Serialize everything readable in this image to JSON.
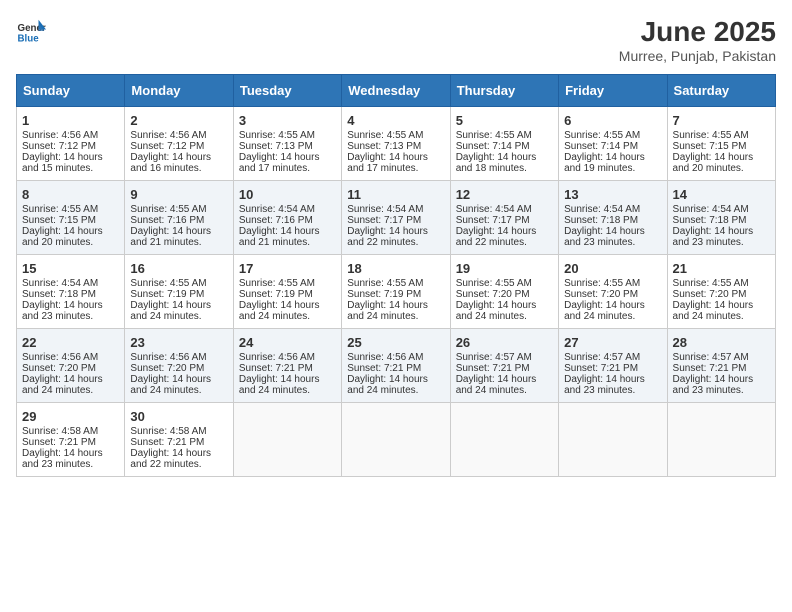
{
  "app": {
    "name_general": "General",
    "name_blue": "Blue"
  },
  "title": "June 2025",
  "subtitle": "Murree, Punjab, Pakistan",
  "weekdays": [
    "Sunday",
    "Monday",
    "Tuesday",
    "Wednesday",
    "Thursday",
    "Friday",
    "Saturday"
  ],
  "weeks": [
    [
      {
        "day": 1,
        "lines": [
          "Sunrise: 4:56 AM",
          "Sunset: 7:12 PM",
          "Daylight: 14 hours",
          "and 15 minutes."
        ]
      },
      {
        "day": 2,
        "lines": [
          "Sunrise: 4:56 AM",
          "Sunset: 7:12 PM",
          "Daylight: 14 hours",
          "and 16 minutes."
        ]
      },
      {
        "day": 3,
        "lines": [
          "Sunrise: 4:55 AM",
          "Sunset: 7:13 PM",
          "Daylight: 14 hours",
          "and 17 minutes."
        ]
      },
      {
        "day": 4,
        "lines": [
          "Sunrise: 4:55 AM",
          "Sunset: 7:13 PM",
          "Daylight: 14 hours",
          "and 17 minutes."
        ]
      },
      {
        "day": 5,
        "lines": [
          "Sunrise: 4:55 AM",
          "Sunset: 7:14 PM",
          "Daylight: 14 hours",
          "and 18 minutes."
        ]
      },
      {
        "day": 6,
        "lines": [
          "Sunrise: 4:55 AM",
          "Sunset: 7:14 PM",
          "Daylight: 14 hours",
          "and 19 minutes."
        ]
      },
      {
        "day": 7,
        "lines": [
          "Sunrise: 4:55 AM",
          "Sunset: 7:15 PM",
          "Daylight: 14 hours",
          "and 20 minutes."
        ]
      }
    ],
    [
      {
        "day": 8,
        "lines": [
          "Sunrise: 4:55 AM",
          "Sunset: 7:15 PM",
          "Daylight: 14 hours",
          "and 20 minutes."
        ]
      },
      {
        "day": 9,
        "lines": [
          "Sunrise: 4:55 AM",
          "Sunset: 7:16 PM",
          "Daylight: 14 hours",
          "and 21 minutes."
        ]
      },
      {
        "day": 10,
        "lines": [
          "Sunrise: 4:54 AM",
          "Sunset: 7:16 PM",
          "Daylight: 14 hours",
          "and 21 minutes."
        ]
      },
      {
        "day": 11,
        "lines": [
          "Sunrise: 4:54 AM",
          "Sunset: 7:17 PM",
          "Daylight: 14 hours",
          "and 22 minutes."
        ]
      },
      {
        "day": 12,
        "lines": [
          "Sunrise: 4:54 AM",
          "Sunset: 7:17 PM",
          "Daylight: 14 hours",
          "and 22 minutes."
        ]
      },
      {
        "day": 13,
        "lines": [
          "Sunrise: 4:54 AM",
          "Sunset: 7:18 PM",
          "Daylight: 14 hours",
          "and 23 minutes."
        ]
      },
      {
        "day": 14,
        "lines": [
          "Sunrise: 4:54 AM",
          "Sunset: 7:18 PM",
          "Daylight: 14 hours",
          "and 23 minutes."
        ]
      }
    ],
    [
      {
        "day": 15,
        "lines": [
          "Sunrise: 4:54 AM",
          "Sunset: 7:18 PM",
          "Daylight: 14 hours",
          "and 23 minutes."
        ]
      },
      {
        "day": 16,
        "lines": [
          "Sunrise: 4:55 AM",
          "Sunset: 7:19 PM",
          "Daylight: 14 hours",
          "and 24 minutes."
        ]
      },
      {
        "day": 17,
        "lines": [
          "Sunrise: 4:55 AM",
          "Sunset: 7:19 PM",
          "Daylight: 14 hours",
          "and 24 minutes."
        ]
      },
      {
        "day": 18,
        "lines": [
          "Sunrise: 4:55 AM",
          "Sunset: 7:19 PM",
          "Daylight: 14 hours",
          "and 24 minutes."
        ]
      },
      {
        "day": 19,
        "lines": [
          "Sunrise: 4:55 AM",
          "Sunset: 7:20 PM",
          "Daylight: 14 hours",
          "and 24 minutes."
        ]
      },
      {
        "day": 20,
        "lines": [
          "Sunrise: 4:55 AM",
          "Sunset: 7:20 PM",
          "Daylight: 14 hours",
          "and 24 minutes."
        ]
      },
      {
        "day": 21,
        "lines": [
          "Sunrise: 4:55 AM",
          "Sunset: 7:20 PM",
          "Daylight: 14 hours",
          "and 24 minutes."
        ]
      }
    ],
    [
      {
        "day": 22,
        "lines": [
          "Sunrise: 4:56 AM",
          "Sunset: 7:20 PM",
          "Daylight: 14 hours",
          "and 24 minutes."
        ]
      },
      {
        "day": 23,
        "lines": [
          "Sunrise: 4:56 AM",
          "Sunset: 7:20 PM",
          "Daylight: 14 hours",
          "and 24 minutes."
        ]
      },
      {
        "day": 24,
        "lines": [
          "Sunrise: 4:56 AM",
          "Sunset: 7:21 PM",
          "Daylight: 14 hours",
          "and 24 minutes."
        ]
      },
      {
        "day": 25,
        "lines": [
          "Sunrise: 4:56 AM",
          "Sunset: 7:21 PM",
          "Daylight: 14 hours",
          "and 24 minutes."
        ]
      },
      {
        "day": 26,
        "lines": [
          "Sunrise: 4:57 AM",
          "Sunset: 7:21 PM",
          "Daylight: 14 hours",
          "and 24 minutes."
        ]
      },
      {
        "day": 27,
        "lines": [
          "Sunrise: 4:57 AM",
          "Sunset: 7:21 PM",
          "Daylight: 14 hours",
          "and 23 minutes."
        ]
      },
      {
        "day": 28,
        "lines": [
          "Sunrise: 4:57 AM",
          "Sunset: 7:21 PM",
          "Daylight: 14 hours",
          "and 23 minutes."
        ]
      }
    ],
    [
      {
        "day": 29,
        "lines": [
          "Sunrise: 4:58 AM",
          "Sunset: 7:21 PM",
          "Daylight: 14 hours",
          "and 23 minutes."
        ]
      },
      {
        "day": 30,
        "lines": [
          "Sunrise: 4:58 AM",
          "Sunset: 7:21 PM",
          "Daylight: 14 hours",
          "and 22 minutes."
        ]
      },
      null,
      null,
      null,
      null,
      null
    ]
  ]
}
